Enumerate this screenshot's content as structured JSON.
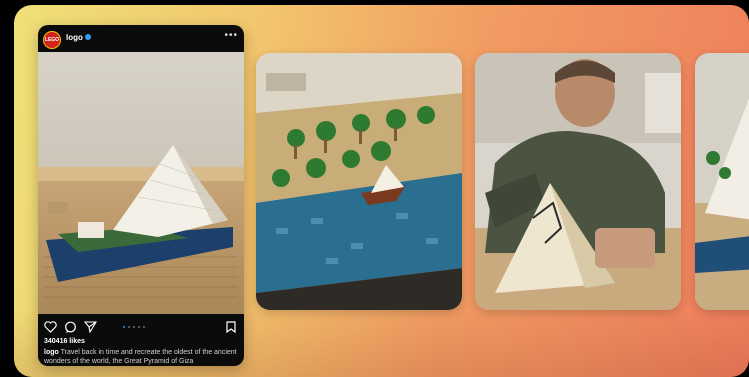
{
  "post": {
    "avatar_text": "LEGO",
    "username": "logo",
    "more": "•••",
    "likes": "340416 likes",
    "caption_user": "logo",
    "caption_text": " Travel back in time and recreate the oldest of the ancient wonders of the world, the Great Pyramid of Giza"
  },
  "carousel": {
    "active_index": 0,
    "count": 5
  },
  "colors": {
    "background_left": "#efe077",
    "background_right": "#ef7d5c",
    "avatar": "#d2231c",
    "verified": "#3897f0"
  },
  "icons": [
    "heart-icon",
    "comment-icon",
    "share-icon",
    "bookmark-icon",
    "verified-icon",
    "more-icon"
  ]
}
